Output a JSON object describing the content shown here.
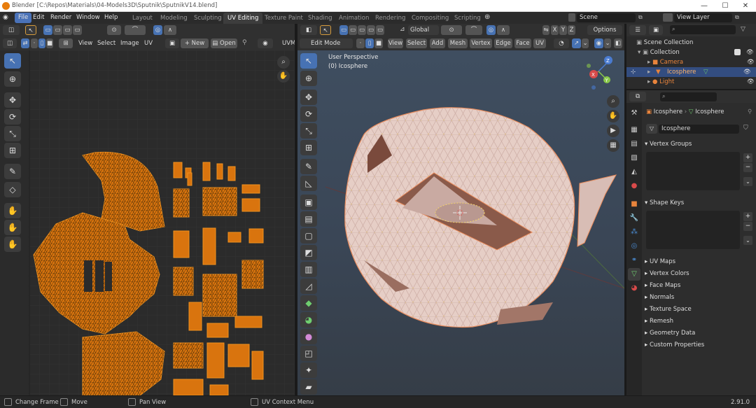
{
  "window": {
    "title": "Blender [C:\\Repos\\Materials\\04-Models3D\\Sputnik\\SputnikV14.blend]",
    "minimize": "—",
    "maximize": "☐",
    "close": "✕"
  },
  "menus": [
    "File",
    "Edit",
    "Render",
    "Window",
    "Help"
  ],
  "workspaces": [
    "Layout",
    "Modeling",
    "Sculpting",
    "UV Editing",
    "Texture Paint",
    "Shading",
    "Animation",
    "Rendering",
    "Compositing",
    "Scripting"
  ],
  "active_workspace": "UV Editing",
  "scene": {
    "name": "Scene",
    "view_layer": "View Layer"
  },
  "uv_editor": {
    "menus": [
      "View",
      "Select",
      "Image",
      "UV"
    ],
    "new_label": "New",
    "open_label": "Open",
    "uv_map_label": "UVM"
  },
  "viewport": {
    "mode": "Edit Mode",
    "menus": [
      "View",
      "Select",
      "Add",
      "Mesh",
      "Vertex",
      "Edge",
      "Face",
      "UV"
    ],
    "orientation": "Global",
    "axes": [
      "X",
      "Y",
      "Z"
    ],
    "options_label": "Options",
    "perspective_label": "User Perspective",
    "object_label": "(0) Icosphere"
  },
  "outliner": {
    "search_placeholder": "",
    "rows": [
      {
        "label": "Scene Collection"
      },
      {
        "label": "Collection"
      },
      {
        "label": "Camera"
      },
      {
        "label": "Icosphere"
      },
      {
        "label": "Light"
      }
    ]
  },
  "properties": {
    "breadcrumb_obj": "Icosphere",
    "breadcrumb_mesh": "Icosphere",
    "mesh_name": "Icosphere",
    "sections": [
      "Vertex Groups",
      "Shape Keys",
      "UV Maps",
      "Vertex Colors",
      "Face Maps",
      "Normals",
      "Texture Space",
      "Remesh",
      "Geometry Data",
      "Custom Properties"
    ]
  },
  "statusbar": {
    "items": [
      "Change Frame",
      "Move",
      "Pan View",
      "UV Context Menu"
    ],
    "version": "2.91.0"
  },
  "colors": {
    "accent": "#4772b3",
    "uv_fill": "#e07a10",
    "mesh_fill": "#e8cfc8",
    "object_orange": "#e8843c"
  }
}
